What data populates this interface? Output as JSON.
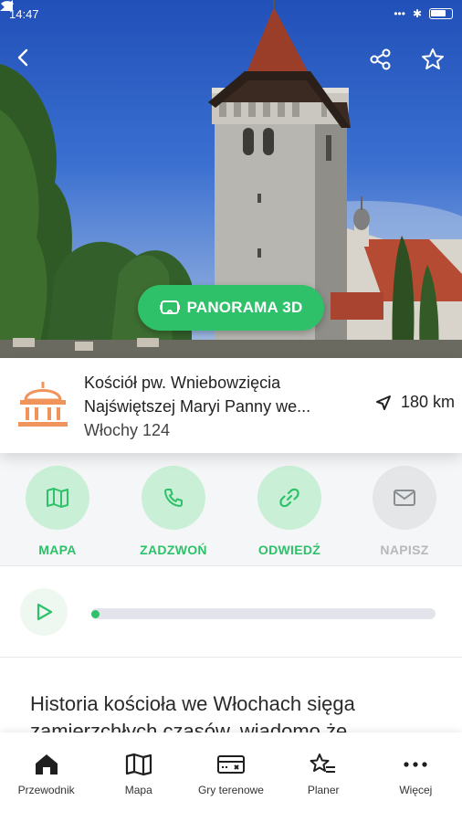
{
  "status_bar": {
    "time": "14:47"
  },
  "hero": {
    "panorama_button_label": "PANORAMA 3D"
  },
  "place": {
    "name_line1": "Kościół pw. Wniebowzięcia",
    "name_line2": "Najświętszej Maryi Panny we...",
    "address": "Włochy 124",
    "distance": "180 km",
    "icon": "museum-icon"
  },
  "actions": [
    {
      "label": "MAPA",
      "icon": "map-icon",
      "enabled": true
    },
    {
      "label": "ZADZWOŃ",
      "icon": "phone-icon",
      "enabled": true
    },
    {
      "label": "ODWIEDŹ",
      "icon": "link-icon",
      "enabled": true
    },
    {
      "label": "NAPISZ",
      "icon": "mail-icon",
      "enabled": false
    }
  ],
  "audio": {
    "progress": 0.0
  },
  "description": {
    "text": "Historia kościoła we Włochach sięga zamierzchłych czasów, wiadomo że"
  },
  "bottom_nav": [
    {
      "label": "Przewodnik",
      "icon": "home-icon",
      "active": true
    },
    {
      "label": "Mapa",
      "icon": "map-icon"
    },
    {
      "label": "Gry terenowe",
      "icon": "game-card-icon"
    },
    {
      "label": "Planer",
      "icon": "star-list-icon"
    },
    {
      "label": "Więcej",
      "icon": "more-icon"
    }
  ],
  "colors": {
    "accent": "#2ec16a",
    "accent_light": "#c9f0d7",
    "icon_orange": "#f0945c",
    "disabled": "#b6b9bc"
  }
}
